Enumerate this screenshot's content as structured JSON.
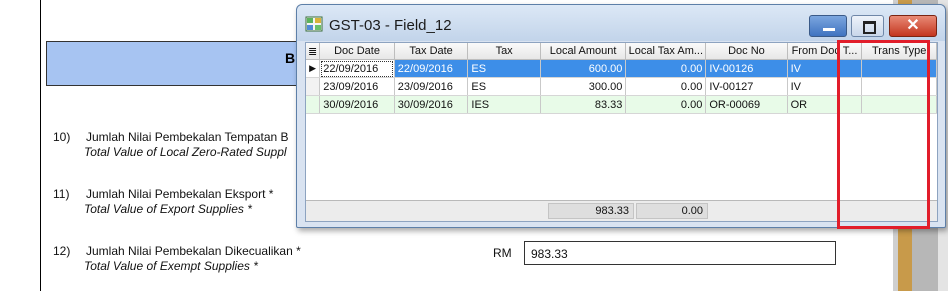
{
  "form": {
    "band_text": "B",
    "q10": {
      "num": "10)",
      "ms": "Jumlah Nilai Pembekalan Tempatan B",
      "en": "Total Value of Local Zero-Rated Suppl"
    },
    "q11": {
      "num": "11)",
      "ms": "Jumlah Nilai Pembekalan Eksport *",
      "en": "Total Value of Export Supplies  *"
    },
    "q12": {
      "num": "12)",
      "ms": "Jumlah Nilai Pembekalan Dikecualikan *",
      "en": "Total Value of Exempt Supplies  *"
    },
    "rm_label": "RM",
    "rm_value": "983.33"
  },
  "window": {
    "title": "GST-03 - Field_12",
    "close_glyph": "✕",
    "columns": [
      "Doc Date",
      "Tax Date",
      "Tax",
      "Local Amount",
      "Local Tax Am...",
      "Doc No",
      "From Doc T...",
      "Trans Type"
    ],
    "rows": [
      {
        "indicator": "▶",
        "doc_date": "22/09/2016",
        "tax_date": "22/09/2016",
        "tax": "ES",
        "local_amount": "600.00",
        "local_tax": "0.00",
        "doc_no": "IV-00126",
        "from_doc": "IV",
        "trans_type": ""
      },
      {
        "indicator": "",
        "doc_date": "23/09/2016",
        "tax_date": "23/09/2016",
        "tax": "ES",
        "local_amount": "300.00",
        "local_tax": "0.00",
        "doc_no": "IV-00127",
        "from_doc": "IV",
        "trans_type": ""
      },
      {
        "indicator": "",
        "doc_date": "30/09/2016",
        "tax_date": "30/09/2016",
        "tax": "IES",
        "local_amount": "83.33",
        "local_tax": "0.00",
        "doc_no": "OR-00069",
        "from_doc": "OR",
        "trans_type": ""
      }
    ],
    "totals": {
      "local_amount": "983.33",
      "local_tax": "0.00"
    }
  },
  "colors": {
    "selection": "#3d8ee8",
    "alt_row": "#e8fbe8",
    "highlight": "#e11d2a",
    "band": "#a7c4f2"
  }
}
